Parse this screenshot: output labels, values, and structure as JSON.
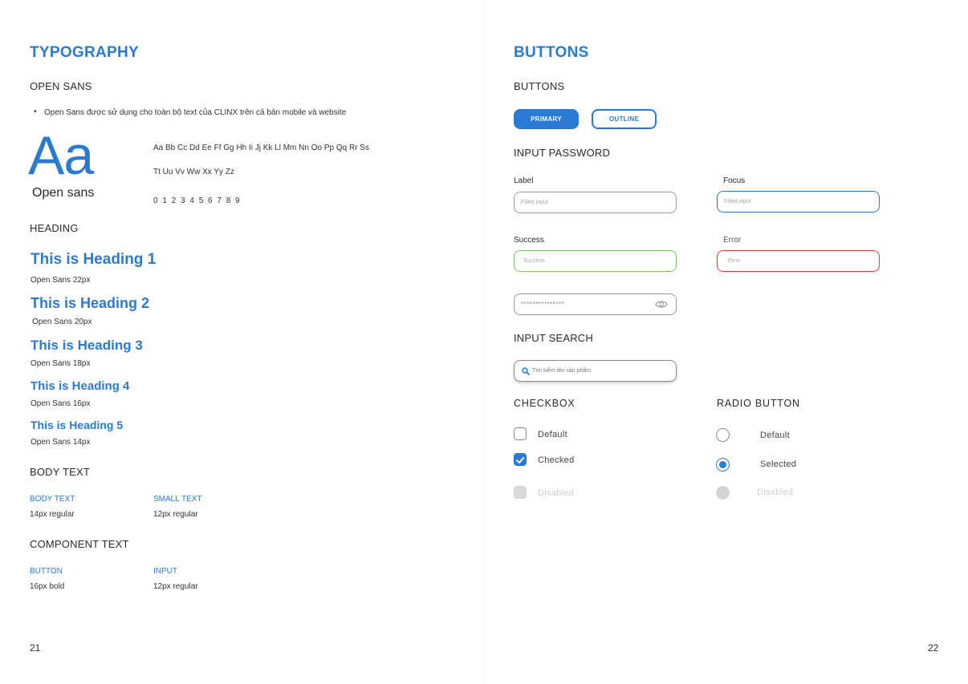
{
  "left": {
    "title": "TYPOGRAPHY",
    "open_sans": {
      "subtitle": "OPEN SANS",
      "bullet": "Open Sans được sử dụng cho toàn bộ text của CLINX trên cả bản mobile và website",
      "specimen_glyph": "Aa",
      "specimen_name": "Open sans",
      "alphabet_line1": "Aa Bb Cc Dd Ee Ff Gg Hh Ii Jj Kk Ll Mm Nn Oo Pp Qq Rr Ss",
      "alphabet_line2": "Tt Uu Vv Ww Xx Yy Zz",
      "digits": "0 1 2 3 4 5 6 7 8 9"
    },
    "heading_section": {
      "subtitle": "HEADING",
      "items": [
        {
          "text": "This is Heading 1",
          "spec": "Open Sans 22px"
        },
        {
          "text": "This is Heading 2",
          "spec": "Open Sans 20px"
        },
        {
          "text": "This is Heading 3",
          "spec": "Open Sans 18px"
        },
        {
          "text": "This is Heading 4",
          "spec": "Open Sans 16px"
        },
        {
          "text": "This is Heading 5",
          "spec": "Open Sans 14px"
        }
      ]
    },
    "body_text": {
      "subtitle": "BODY TEXT",
      "col1_label": "BODY TEXT",
      "col1_spec": "14px regular",
      "col2_label": "SMALL TEXT",
      "col2_spec": "12px regular"
    },
    "component_text": {
      "subtitle": "COMPONENT TEXT",
      "col1_label": "BUTTON",
      "col1_spec": "16px bold",
      "col2_label": "INPUT",
      "col2_spec": "12px regular"
    },
    "page_number": "21"
  },
  "right": {
    "title": "BUTTONS",
    "buttons": {
      "subtitle": "BUTTONS",
      "primary_label": "PRIMARY",
      "outline_label": "OUTLINE"
    },
    "input_password": {
      "subtitle": "INPUT PASSWORD",
      "label_label": "Label",
      "label_placeholder": "Filled input",
      "focus_label": "Focus",
      "focus_placeholder": "Filled input",
      "success_label": "Success",
      "success_value": "Success",
      "error_label": "Error",
      "error_value": "Error",
      "password_mask": "***************"
    },
    "input_search": {
      "subtitle": "INPUT SEARCH",
      "placeholder": "Tìm kiếm tên sản phẩm"
    },
    "checkbox": {
      "subtitle": "CHECKBOX",
      "default_label": "Default",
      "checked_label": "Checked",
      "disabled_label": "Disabled"
    },
    "radio": {
      "subtitle": "RADIO BUTTON",
      "default_label": "Default",
      "selected_label": "Selected",
      "disabled_label": "Disabled"
    },
    "page_number": "22"
  },
  "colors": {
    "brand_blue": "#2a7ad3",
    "success_green": "#7cc35a",
    "error_red": "#e23b3b",
    "disabled_gray": "#d6d6d6"
  },
  "icons": {
    "search": "search-icon",
    "eye": "eye-icon",
    "check": "check-icon"
  }
}
